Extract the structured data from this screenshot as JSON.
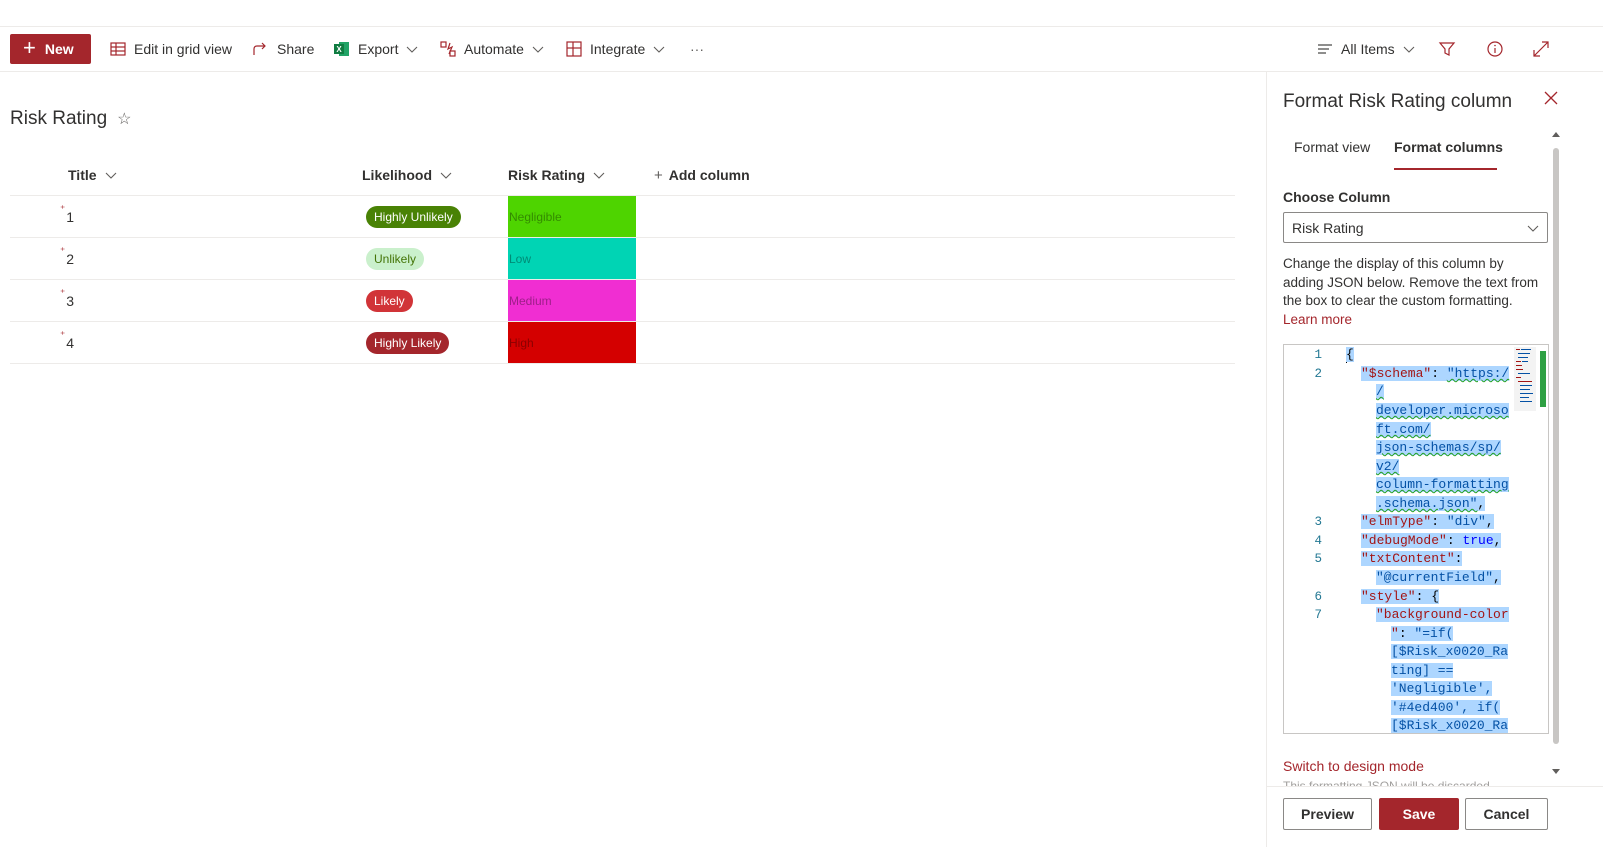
{
  "command_bar": {
    "new_label": "New",
    "edit_grid_label": "Edit in grid view",
    "share_label": "Share",
    "export_label": "Export",
    "automate_label": "Automate",
    "integrate_label": "Integrate",
    "more_label": "···",
    "view_label": "All Items"
  },
  "list": {
    "title": "Risk Rating",
    "columns": {
      "title": "Title",
      "likelihood": "Likelihood",
      "risk_rating": "Risk Rating",
      "add_column": "Add column"
    },
    "rows": [
      {
        "title": "1",
        "likelihood": "Highly Unlikely",
        "likelihood_bg": "#498205",
        "likelihood_fg": "#ffffff",
        "risk": "Negligible",
        "risk_bg": "#4ed400"
      },
      {
        "title": "2",
        "likelihood": "Unlikely",
        "likelihood_bg": "#caf0cc",
        "likelihood_fg": "#437406",
        "risk": "Low",
        "risk_bg": "#00d4b4"
      },
      {
        "title": "3",
        "likelihood": "Likely",
        "likelihood_bg": "#d13438",
        "likelihood_fg": "#ffffff",
        "risk": "Medium",
        "risk_bg": "#f02ed2"
      },
      {
        "title": "4",
        "likelihood": "Highly Likely",
        "likelihood_bg": "#a4262c",
        "likelihood_fg": "#ffffff",
        "risk": "High",
        "risk_bg": "#d40000"
      }
    ]
  },
  "panel": {
    "title": "Format Risk Rating column",
    "tab_view": "Format view",
    "tab_columns": "Format columns",
    "choose_column_label": "Choose Column",
    "selected_column": "Risk Rating",
    "description": "Change the display of this column by adding JSON below. Remove the text from the box to clear the custom formatting.",
    "learn_more": "Learn more",
    "switch_design": "Switch to design mode",
    "fade_text": "This formatting JSON will be discarded",
    "preview_label": "Preview",
    "save_label": "Save",
    "cancel_label": "Cancel",
    "line_numbers": [
      "1",
      "2",
      "3",
      "4",
      "5",
      "6",
      "7"
    ],
    "code": {
      "l1": "{",
      "l2a": "\"$schema\"",
      "l2b": ": ",
      "l2c": "\"https:/",
      "l2d": "/",
      "l2e": "developer.microso",
      "l2f": "ft.com/",
      "l2g": "json-schemas/sp/",
      "l2h": "v2/",
      "l2i": "column-formatting",
      "l2j": ".schema.json\"",
      "l3a": "\"elmType\"",
      "l3b": "\"div\"",
      "l4a": "\"debugMode\"",
      "l4b": "true",
      "l5a": "\"txtContent\"",
      "l5b": "\"@currentField\"",
      "l6a": "\"style\"",
      "l6b": "{",
      "l7a": "\"background-color",
      "l7b": "\"",
      "l7c": "\"=if(",
      "l7d": "[$Risk_x0020_Ra",
      "l7e": "ting] ==",
      "l7f": "'Negligible',",
      "l7g": "'#4ed400', if(",
      "l7h": "[$Risk_x0020_Ra"
    }
  },
  "colors": {
    "accent": "#a4262c",
    "border": "#edebe9"
  }
}
